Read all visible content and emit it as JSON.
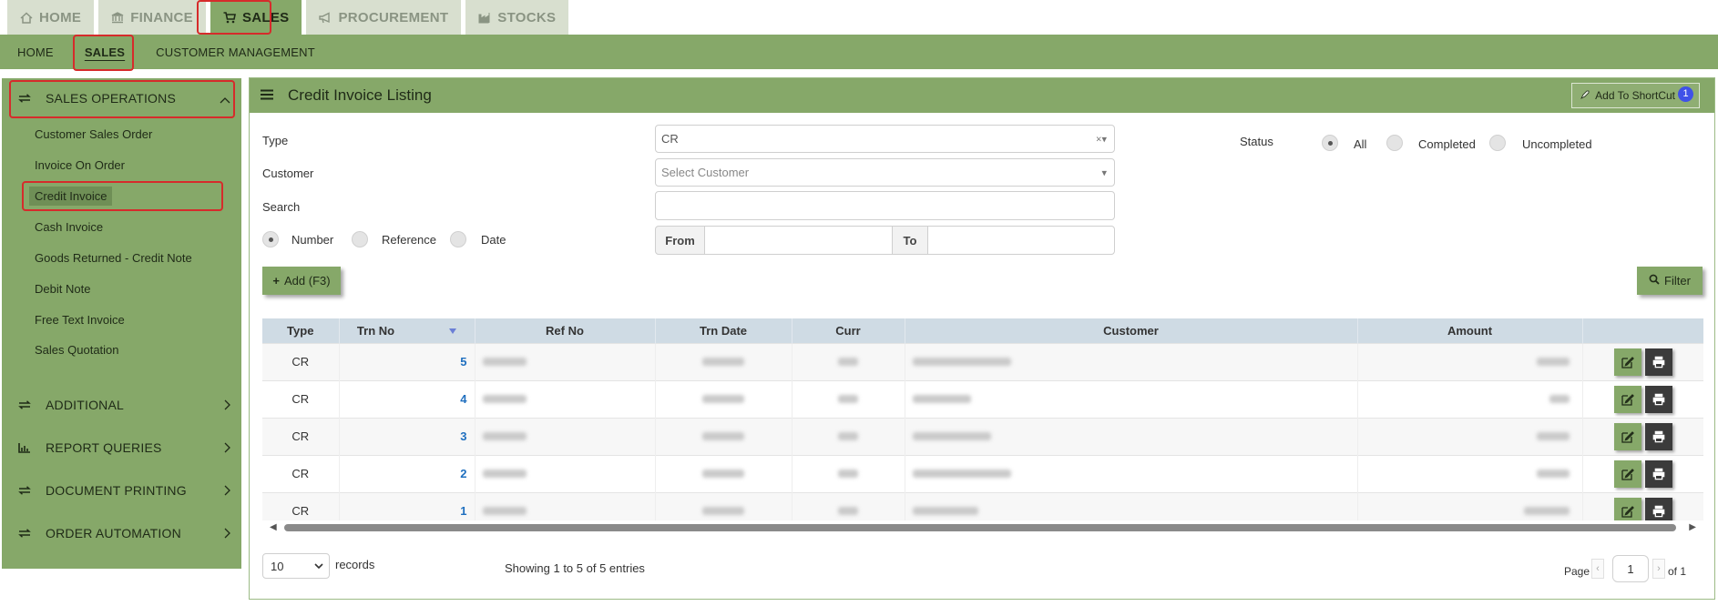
{
  "top_tabs": [
    {
      "label": "HOME",
      "icon": "home-icon"
    },
    {
      "label": "FINANCE",
      "icon": "bank-icon"
    },
    {
      "label": "SALES",
      "icon": "cart-icon"
    },
    {
      "label": "PROCUREMENT",
      "icon": "bullhorn-icon"
    },
    {
      "label": "STOCKS",
      "icon": "factory-icon"
    }
  ],
  "subnav": [
    "HOME",
    "SALES",
    "CUSTOMER MANAGEMENT"
  ],
  "sidebar": {
    "group_operations": "SALES OPERATIONS",
    "items": [
      "Customer Sales Order",
      "Invoice On Order",
      "Credit Invoice",
      "Cash Invoice",
      "Goods Returned - Credit Note",
      "Debit Note",
      "Free Text Invoice",
      "Sales Quotation"
    ],
    "groups": [
      "ADDITIONAL",
      "REPORT QUERIES",
      "DOCUMENT PRINTING",
      "ORDER AUTOMATION"
    ]
  },
  "panel": {
    "title": "Credit Invoice Listing",
    "shortcut_label": "Add To ShortCut",
    "shortcut_badge": "1"
  },
  "filters": {
    "type_label": "Type",
    "type_value": "CR",
    "customer_label": "Customer",
    "customer_placeholder": "Select Customer",
    "search_label": "Search",
    "search_value": "",
    "search_by": [
      "Number",
      "Reference",
      "Date"
    ],
    "from_label": "From",
    "to_label": "To",
    "status_label": "Status",
    "status_options": [
      "All",
      "Completed",
      "Uncompleted"
    ]
  },
  "buttons": {
    "add": "Add (F3)",
    "filter": "Filter"
  },
  "table": {
    "columns": [
      "Type",
      "Trn No",
      "Ref No",
      "Trn Date",
      "Curr",
      "Customer",
      "Amount"
    ],
    "rows": [
      {
        "type": "CR",
        "trn": "5"
      },
      {
        "type": "CR",
        "trn": "4"
      },
      {
        "type": "CR",
        "trn": "3"
      },
      {
        "type": "CR",
        "trn": "2"
      },
      {
        "type": "CR",
        "trn": "1"
      }
    ]
  },
  "footer": {
    "page_size": "10",
    "records_label": "records",
    "showing": "Showing 1 to 5 of 5 entries",
    "page_label": "Page",
    "page_current": "1",
    "page_total": "of 1"
  },
  "colors": {
    "accent": "#86a869",
    "highlight": "#d62b2b",
    "badge": "#3f51e8",
    "table_header": "#cfdbe4"
  }
}
